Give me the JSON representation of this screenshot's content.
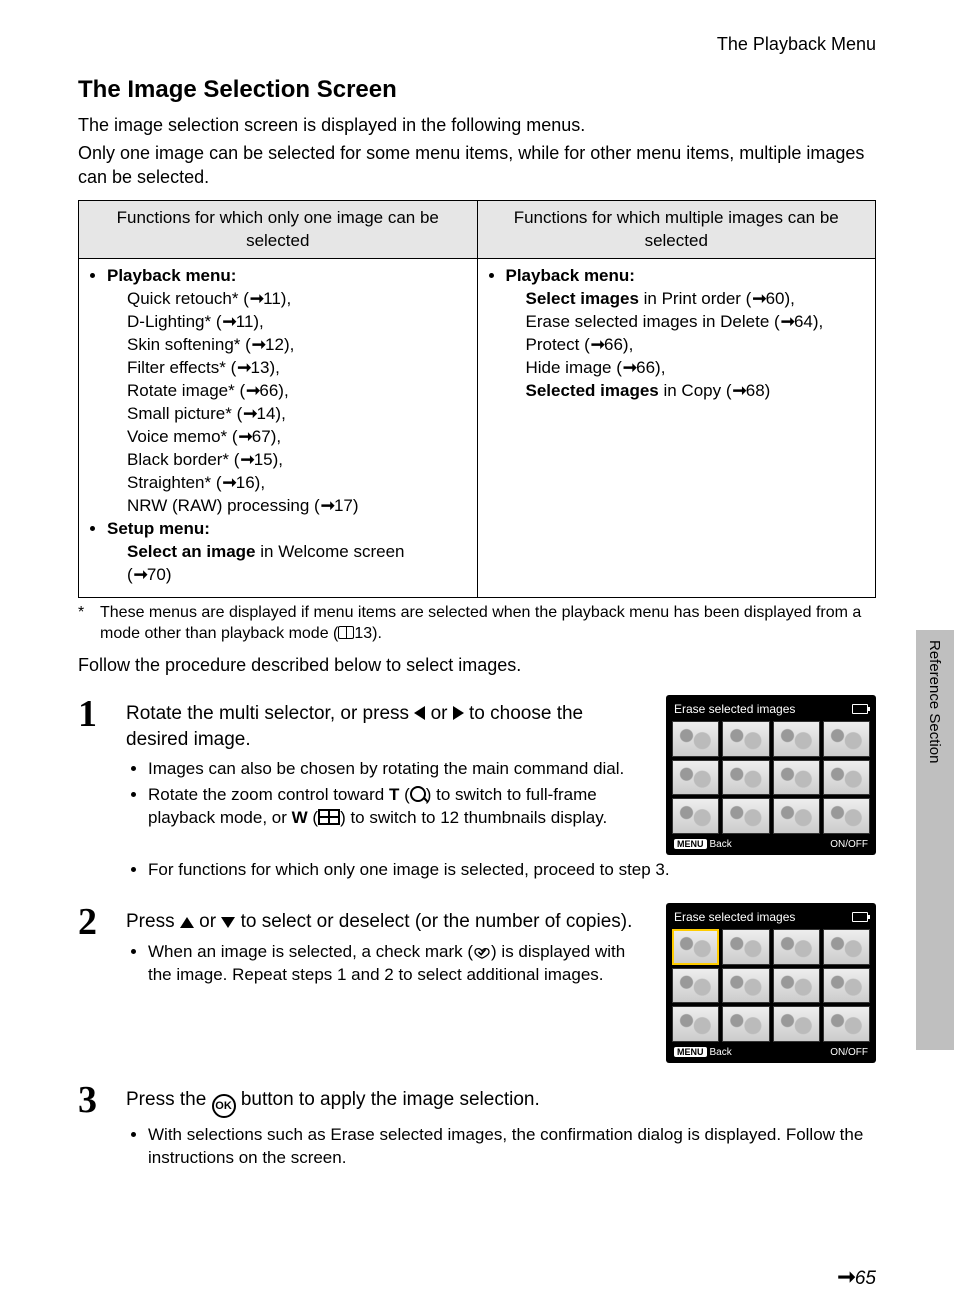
{
  "header": {
    "section": "The Playback Menu"
  },
  "title": "The Image Selection Screen",
  "intro_lines": [
    "The image selection screen is displayed in the following menus.",
    "Only one image can be selected for some menu items, while for other menu items, multiple images can be selected."
  ],
  "table": {
    "head_left": "Functions for which only one image can be selected",
    "head_right": "Functions for which multiple images can be selected",
    "left": {
      "group1_title": "Playback menu:",
      "group1_items": [
        {
          "label": "Quick retouch*",
          "ref": "11",
          "tail": ","
        },
        {
          "label": "D-Lighting*",
          "ref": "11",
          "tail": ","
        },
        {
          "label": "Skin softening*",
          "ref": "12",
          "tail": ","
        },
        {
          "label": "Filter effects*",
          "ref": "13",
          "tail": ","
        },
        {
          "label": "Rotate image*",
          "ref": "66",
          "tail": ","
        },
        {
          "label": "Small picture*",
          "ref": "14",
          "tail": ","
        },
        {
          "label": "Voice memo*",
          "ref": "67",
          "tail": ","
        },
        {
          "label": "Black border*",
          "ref": "15",
          "tail": ","
        },
        {
          "label": "Straighten*",
          "ref": "16",
          "tail": ","
        },
        {
          "label": "NRW (RAW) processing",
          "ref": "17",
          "tail": ""
        }
      ],
      "group2_title": "Setup menu:",
      "group2_bold": "Select an image",
      "group2_rest": " in Welcome screen",
      "group2_ref": "70"
    },
    "right": {
      "group_title": "Playback menu:",
      "items": [
        {
          "bold": "Select images",
          "rest": " in Print order",
          "ref": "60",
          "tail": ","
        },
        {
          "plain": "Erase selected images in Delete",
          "ref": "64",
          "tail": ","
        },
        {
          "plain": "Protect",
          "ref": "66",
          "tail": ","
        },
        {
          "plain": "Hide image",
          "ref": "66",
          "tail": ","
        },
        {
          "bold": "Selected images",
          "rest": " in Copy",
          "ref": "68",
          "tail": ""
        }
      ]
    }
  },
  "footnote": {
    "marker": "*",
    "text_a": "These menus are displayed if menu items are selected when the playback menu has been displayed from a mode other than playback mode (",
    "book_ref": "13",
    "text_b": ")."
  },
  "follow": "Follow the procedure described below to select images.",
  "steps": [
    {
      "num": "1",
      "title_a": "Rotate the multi selector, or press ",
      "title_b": " or ",
      "title_c": " to choose the desired image.",
      "subs": [
        "Images can also be chosen by rotating the main command dial.",
        "Rotate the zoom control toward __T__ (__MAG__) to switch to full-frame playback mode, or __W__ (__GRID__) to switch to 12 thumbnails display.",
        "For functions for which only one image is selected, proceed to step 3."
      ],
      "lcd": {
        "title": "Erase selected images",
        "foot_back": "Back",
        "foot_onoff": "ON/OFF",
        "selected": false
      }
    },
    {
      "num": "2",
      "title_a": "Press ",
      "title_b": " or ",
      "title_c": " to select or deselect (or the number of copies).",
      "subs": [
        "When an image is selected, a check mark (__CHECK__) is displayed with the image. Repeat steps 1 and 2 to select additional images."
      ],
      "lcd": {
        "title": "Erase selected images",
        "foot_back": "Back",
        "foot_onoff": "ON/OFF",
        "selected": true
      }
    },
    {
      "num": "3",
      "title_a": "Press the ",
      "title_ok": "OK",
      "title_c": " button to apply the image selection.",
      "subs": [
        "With selections such as Erase selected images, the confirmation dialog is displayed. Follow the instructions on the screen."
      ]
    }
  ],
  "side_label": "Reference Section",
  "page_number": "65"
}
